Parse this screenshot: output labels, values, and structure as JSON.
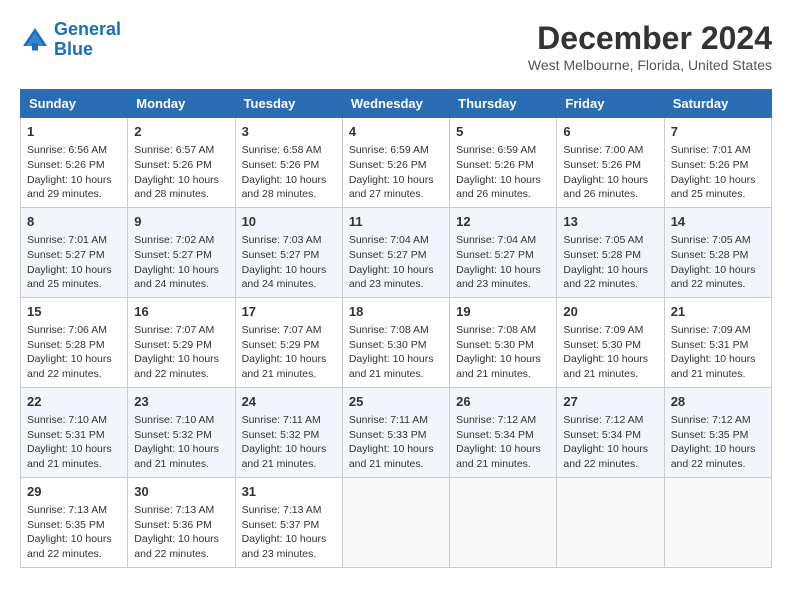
{
  "logo": {
    "line1": "General",
    "line2": "Blue"
  },
  "title": "December 2024",
  "subtitle": "West Melbourne, Florida, United States",
  "days_header": [
    "Sunday",
    "Monday",
    "Tuesday",
    "Wednesday",
    "Thursday",
    "Friday",
    "Saturday"
  ],
  "weeks": [
    [
      {
        "day": "1",
        "info": "Sunrise: 6:56 AM\nSunset: 5:26 PM\nDaylight: 10 hours\nand 29 minutes."
      },
      {
        "day": "2",
        "info": "Sunrise: 6:57 AM\nSunset: 5:26 PM\nDaylight: 10 hours\nand 28 minutes."
      },
      {
        "day": "3",
        "info": "Sunrise: 6:58 AM\nSunset: 5:26 PM\nDaylight: 10 hours\nand 28 minutes."
      },
      {
        "day": "4",
        "info": "Sunrise: 6:59 AM\nSunset: 5:26 PM\nDaylight: 10 hours\nand 27 minutes."
      },
      {
        "day": "5",
        "info": "Sunrise: 6:59 AM\nSunset: 5:26 PM\nDaylight: 10 hours\nand 26 minutes."
      },
      {
        "day": "6",
        "info": "Sunrise: 7:00 AM\nSunset: 5:26 PM\nDaylight: 10 hours\nand 26 minutes."
      },
      {
        "day": "7",
        "info": "Sunrise: 7:01 AM\nSunset: 5:26 PM\nDaylight: 10 hours\nand 25 minutes."
      }
    ],
    [
      {
        "day": "8",
        "info": "Sunrise: 7:01 AM\nSunset: 5:27 PM\nDaylight: 10 hours\nand 25 minutes."
      },
      {
        "day": "9",
        "info": "Sunrise: 7:02 AM\nSunset: 5:27 PM\nDaylight: 10 hours\nand 24 minutes."
      },
      {
        "day": "10",
        "info": "Sunrise: 7:03 AM\nSunset: 5:27 PM\nDaylight: 10 hours\nand 24 minutes."
      },
      {
        "day": "11",
        "info": "Sunrise: 7:04 AM\nSunset: 5:27 PM\nDaylight: 10 hours\nand 23 minutes."
      },
      {
        "day": "12",
        "info": "Sunrise: 7:04 AM\nSunset: 5:27 PM\nDaylight: 10 hours\nand 23 minutes."
      },
      {
        "day": "13",
        "info": "Sunrise: 7:05 AM\nSunset: 5:28 PM\nDaylight: 10 hours\nand 22 minutes."
      },
      {
        "day": "14",
        "info": "Sunrise: 7:05 AM\nSunset: 5:28 PM\nDaylight: 10 hours\nand 22 minutes."
      }
    ],
    [
      {
        "day": "15",
        "info": "Sunrise: 7:06 AM\nSunset: 5:28 PM\nDaylight: 10 hours\nand 22 minutes."
      },
      {
        "day": "16",
        "info": "Sunrise: 7:07 AM\nSunset: 5:29 PM\nDaylight: 10 hours\nand 22 minutes."
      },
      {
        "day": "17",
        "info": "Sunrise: 7:07 AM\nSunset: 5:29 PM\nDaylight: 10 hours\nand 21 minutes."
      },
      {
        "day": "18",
        "info": "Sunrise: 7:08 AM\nSunset: 5:30 PM\nDaylight: 10 hours\nand 21 minutes."
      },
      {
        "day": "19",
        "info": "Sunrise: 7:08 AM\nSunset: 5:30 PM\nDaylight: 10 hours\nand 21 minutes."
      },
      {
        "day": "20",
        "info": "Sunrise: 7:09 AM\nSunset: 5:30 PM\nDaylight: 10 hours\nand 21 minutes."
      },
      {
        "day": "21",
        "info": "Sunrise: 7:09 AM\nSunset: 5:31 PM\nDaylight: 10 hours\nand 21 minutes."
      }
    ],
    [
      {
        "day": "22",
        "info": "Sunrise: 7:10 AM\nSunset: 5:31 PM\nDaylight: 10 hours\nand 21 minutes."
      },
      {
        "day": "23",
        "info": "Sunrise: 7:10 AM\nSunset: 5:32 PM\nDaylight: 10 hours\nand 21 minutes."
      },
      {
        "day": "24",
        "info": "Sunrise: 7:11 AM\nSunset: 5:32 PM\nDaylight: 10 hours\nand 21 minutes."
      },
      {
        "day": "25",
        "info": "Sunrise: 7:11 AM\nSunset: 5:33 PM\nDaylight: 10 hours\nand 21 minutes."
      },
      {
        "day": "26",
        "info": "Sunrise: 7:12 AM\nSunset: 5:34 PM\nDaylight: 10 hours\nand 21 minutes."
      },
      {
        "day": "27",
        "info": "Sunrise: 7:12 AM\nSunset: 5:34 PM\nDaylight: 10 hours\nand 22 minutes."
      },
      {
        "day": "28",
        "info": "Sunrise: 7:12 AM\nSunset: 5:35 PM\nDaylight: 10 hours\nand 22 minutes."
      }
    ],
    [
      {
        "day": "29",
        "info": "Sunrise: 7:13 AM\nSunset: 5:35 PM\nDaylight: 10 hours\nand 22 minutes."
      },
      {
        "day": "30",
        "info": "Sunrise: 7:13 AM\nSunset: 5:36 PM\nDaylight: 10 hours\nand 22 minutes."
      },
      {
        "day": "31",
        "info": "Sunrise: 7:13 AM\nSunset: 5:37 PM\nDaylight: 10 hours\nand 23 minutes."
      },
      {
        "day": "",
        "info": ""
      },
      {
        "day": "",
        "info": ""
      },
      {
        "day": "",
        "info": ""
      },
      {
        "day": "",
        "info": ""
      }
    ]
  ]
}
